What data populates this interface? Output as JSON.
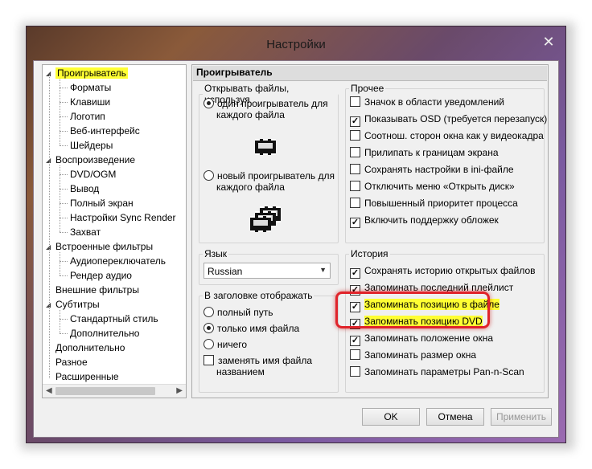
{
  "window": {
    "title": "Настройки",
    "close_glyph": "✕"
  },
  "tree": {
    "items": [
      {
        "label": "Проигрыватель",
        "level": 0,
        "expanded": true,
        "selected": true
      },
      {
        "label": "Форматы",
        "level": 1
      },
      {
        "label": "Клавиши",
        "level": 1
      },
      {
        "label": "Логотип",
        "level": 1
      },
      {
        "label": "Веб-интерфейс",
        "level": 1
      },
      {
        "label": "Шейдеры",
        "level": 1
      },
      {
        "label": "Воспроизведение",
        "level": 0,
        "expanded": true
      },
      {
        "label": "DVD/OGM",
        "level": 1
      },
      {
        "label": "Вывод",
        "level": 1
      },
      {
        "label": "Полный экран",
        "level": 1
      },
      {
        "label": "Настройки Sync Render",
        "level": 1
      },
      {
        "label": "Захват",
        "level": 1
      },
      {
        "label": "Встроенные фильтры",
        "level": 0,
        "expanded": true
      },
      {
        "label": "Аудиопереключатель",
        "level": 1
      },
      {
        "label": "Рендер аудио",
        "level": 1
      },
      {
        "label": "Внешние фильтры",
        "level": 0
      },
      {
        "label": "Субтитры",
        "level": 0,
        "expanded": true
      },
      {
        "label": "Стандартный стиль",
        "level": 1
      },
      {
        "label": "Дополнительно",
        "level": 1
      },
      {
        "label": "Дополнительно",
        "level": 0
      },
      {
        "label": "Разное",
        "level": 0
      },
      {
        "label": "Расширенные",
        "level": 0
      }
    ]
  },
  "panel": {
    "title": "Проигрыватель",
    "open_files": {
      "legend": "Открывать файлы, используя",
      "opt1_line1": "один проигрыватель для",
      "opt1_line2": "каждого файла",
      "opt2_line1": "новый проигрыватель для",
      "opt2_line2": "каждого файла"
    },
    "language": {
      "legend": "Язык",
      "value": "Russian"
    },
    "title_bar": {
      "legend": "В заголовке отображать",
      "full_path": "полный путь",
      "file_name": "только имя файла",
      "nothing": "ничего",
      "replace_line1": "заменять имя файла",
      "replace_line2": "названием"
    },
    "other": {
      "legend": "Прочее",
      "items": [
        {
          "label": "Значок в области уведомлений",
          "checked": false
        },
        {
          "label": "Показывать OSD (требуется перезапуск)",
          "checked": true
        },
        {
          "label": "Соотнош. сторон окна как у видеокадра",
          "checked": false
        },
        {
          "label": "Прилипать к границам экрана",
          "checked": false
        },
        {
          "label": "Сохранять настройки в ini-файле",
          "checked": false
        },
        {
          "label": "Отключить меню «Открыть диск»",
          "checked": false
        },
        {
          "label": "Повышенный приоритет процесса",
          "checked": false
        },
        {
          "label": "Включить поддержку обложек",
          "checked": true
        }
      ]
    },
    "history": {
      "legend": "История",
      "items": [
        {
          "label": "Сохранять историю открытых файлов",
          "checked": true
        },
        {
          "label": "Запоминать последний плейлист",
          "checked": true
        },
        {
          "label": "Запоминать позицию в файле",
          "checked": true,
          "highlighted": true
        },
        {
          "label": "Запоминать позицию DVD",
          "checked": true,
          "highlighted": true
        },
        {
          "label": "Запоминать положение окна",
          "checked": true
        },
        {
          "label": "Запоминать размер окна",
          "checked": false
        },
        {
          "label": "Запоминать параметры Pan-n-Scan",
          "checked": false
        }
      ]
    }
  },
  "buttons": {
    "ok": "OK",
    "cancel": "Отмена",
    "apply": "Применить"
  },
  "colors": {
    "highlight": "#ffff33",
    "annotation": "#e0242b"
  }
}
